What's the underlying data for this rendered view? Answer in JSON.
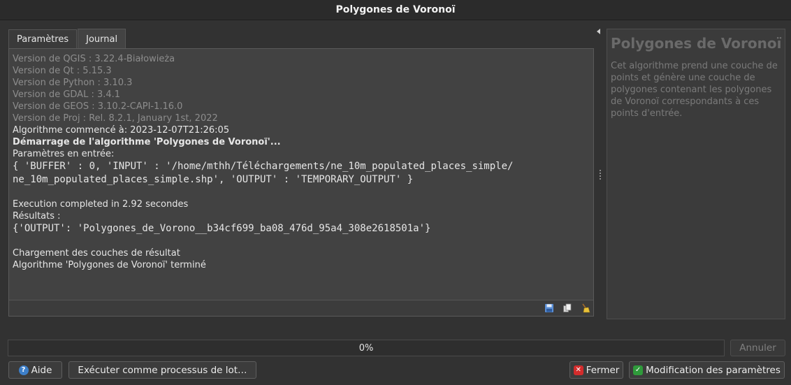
{
  "window": {
    "title": "Polygones de Voronoï"
  },
  "tabs": [
    {
      "label": "Paramètres"
    },
    {
      "label": "Journal"
    }
  ],
  "log": {
    "version_lines": [
      "Version de QGIS : 3.22.4-Białowieża",
      "Version de Qt : 5.15.3",
      "Version de Python : 3.10.3",
      "Version de GDAL : 3.4.1",
      "Version de GEOS : 3.10.2-CAPI-1.16.0",
      "Version de Proj : Rel. 8.2.1, January 1st, 2022"
    ],
    "started": "Algorithme commencé à: 2023-12-07T21:26:05",
    "starting_bold": "Démarrage de l'algorithme 'Polygones de Voronoï'...",
    "params_label": "Paramètres en entrée:",
    "params_line1": "{ 'BUFFER' : 0, 'INPUT' : '/home/mthh/Téléchargements/ne_10m_populated_places_simple/",
    "params_line2": "ne_10m_populated_places_simple.shp', 'OUTPUT' : 'TEMPORARY_OUTPUT' }",
    "exec_completed": "Execution completed in 2.92 secondes",
    "results_label": "Résultats :",
    "results_value": "{'OUTPUT': 'Polygones_de_Vorono__b34cf699_ba08_476d_95a4_308e2618501a'}",
    "loading": "Chargement des couches de résultat",
    "finished": "Algorithme 'Polygones de Voronoï' terminé",
    "footer_icons": [
      "save-icon",
      "copy-icon",
      "clear-icon"
    ]
  },
  "help": {
    "title": "Polygones de Voronoï",
    "description": "Cet algorithme prend une couche de points et génère une couche de polygones contenant les polygones de Voronoï correspondants à ces points d'entrée."
  },
  "progress": {
    "value": 0,
    "text": "0%"
  },
  "buttons": {
    "cancel": "Annuler",
    "help": "Aide",
    "batch": "Exécuter comme processus de lot…",
    "close": "Fermer",
    "change_params": "Modification des paramètres"
  },
  "colors": {
    "background": "#323232",
    "log_background": "#424242",
    "muted_text": "#8d8d8d",
    "help_icon": "#3d7fc9",
    "close_icon": "#d32c2c",
    "check_icon": "#2f9a3b"
  }
}
